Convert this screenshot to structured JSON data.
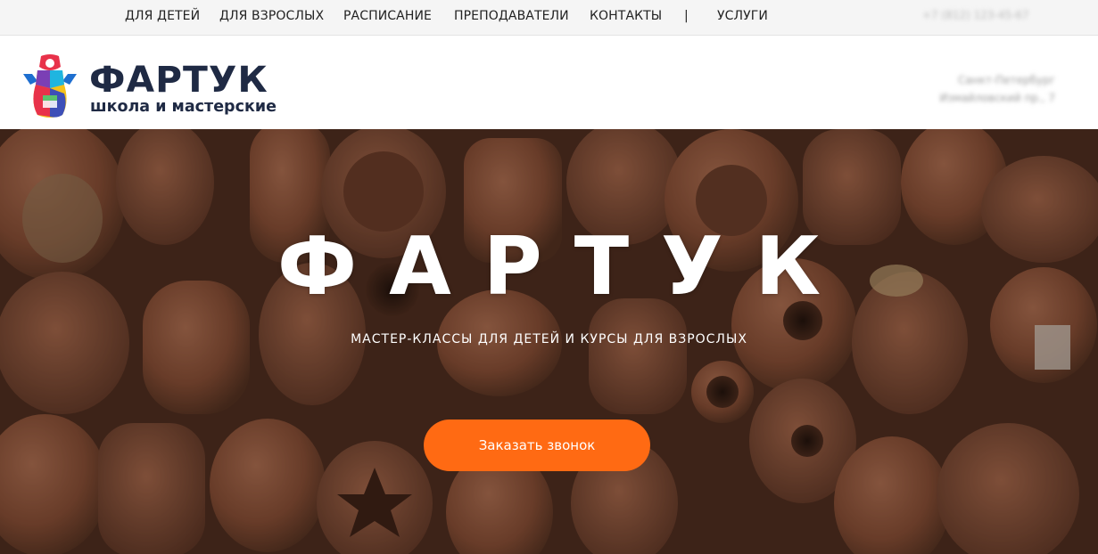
{
  "topnav": {
    "items": [
      "ДЛЯ ДЕТЕЙ",
      "ДЛЯ ВЗРОСЛЫХ",
      "РАСПИСАНИЕ",
      "ПРЕПОДАВАТЕЛИ",
      "КОНТАКТЫ"
    ],
    "separator": "|",
    "services": "УСЛУГИ",
    "phone": "+7 (812) 123-45-67"
  },
  "header": {
    "logo_title": "ФАРТУК",
    "logo_subtitle": "школа и мастерские",
    "address_line1": "Санкт-Петербург",
    "address_line2": "Измайловский пр., 7"
  },
  "hero": {
    "title": "ФАРТУК",
    "subtitle": "МАСТЕР-КЛАССЫ ДЛЯ ДЕТЕЙ И КУРСЫ ДЛЯ ВЗРОСЛЫХ",
    "cta_label": "Заказать звонок"
  },
  "colors": {
    "accent": "#ff6a13",
    "brand_dark": "#1f2a44",
    "terracotta": "#8a4f35"
  },
  "icons": [
    "apron-logo-icon"
  ]
}
